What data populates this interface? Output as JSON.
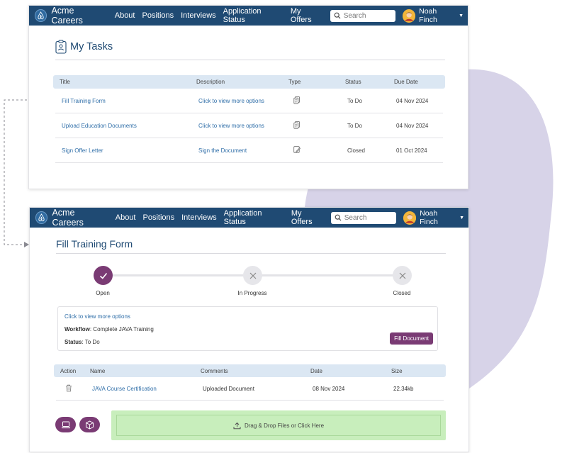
{
  "nav": {
    "brand": "Acme Careers",
    "links": [
      "About",
      "Positions",
      "Interviews",
      "Application Status",
      "My Offers"
    ],
    "search_placeholder": "Search",
    "user_name": "Noah Finch"
  },
  "colors": {
    "nav_bg": "#1f4a73",
    "accent": "#7a3b74",
    "link": "#2f6ea8",
    "drop_zone": "#c8eebc",
    "blob": "#d7d3e8"
  },
  "tasks": {
    "title": "My Tasks",
    "columns": [
      "Title",
      "Description",
      "Type",
      "Status",
      "Due Date"
    ],
    "rows": [
      {
        "title": "Fill Training Form",
        "description": "Click to view more options",
        "type_icon": "document-icon",
        "status": "To Do",
        "due": "04 Nov 2024"
      },
      {
        "title": "Upload Education Documents",
        "description": "Click to view more options",
        "type_icon": "document-icon",
        "status": "To Do",
        "due": "04 Nov 2024"
      },
      {
        "title": "Sign Offer Letter",
        "description": "Sign the Document",
        "type_icon": "sign-icon",
        "status": "Closed",
        "due": "01 Oct 2024"
      }
    ]
  },
  "form": {
    "title": "Fill Training Form",
    "steps": [
      "Open",
      "In Progress",
      "Closed"
    ],
    "info_link": "Click to view more options",
    "workflow_label": "Workflow",
    "workflow_value": ": Complete JAVA Training",
    "status_label": "Status",
    "status_value": ": To Do",
    "fill_button": "Fill Document",
    "doc_columns": [
      "Action",
      "Name",
      "Comments",
      "Date",
      "Size"
    ],
    "docs": [
      {
        "name": "JAVA Course Certification",
        "comments": "Uploaded Document",
        "date": "08 Nov 2024",
        "size": "22.34kb"
      }
    ],
    "drop_text": "Drag & Drop Files or Click Here"
  }
}
